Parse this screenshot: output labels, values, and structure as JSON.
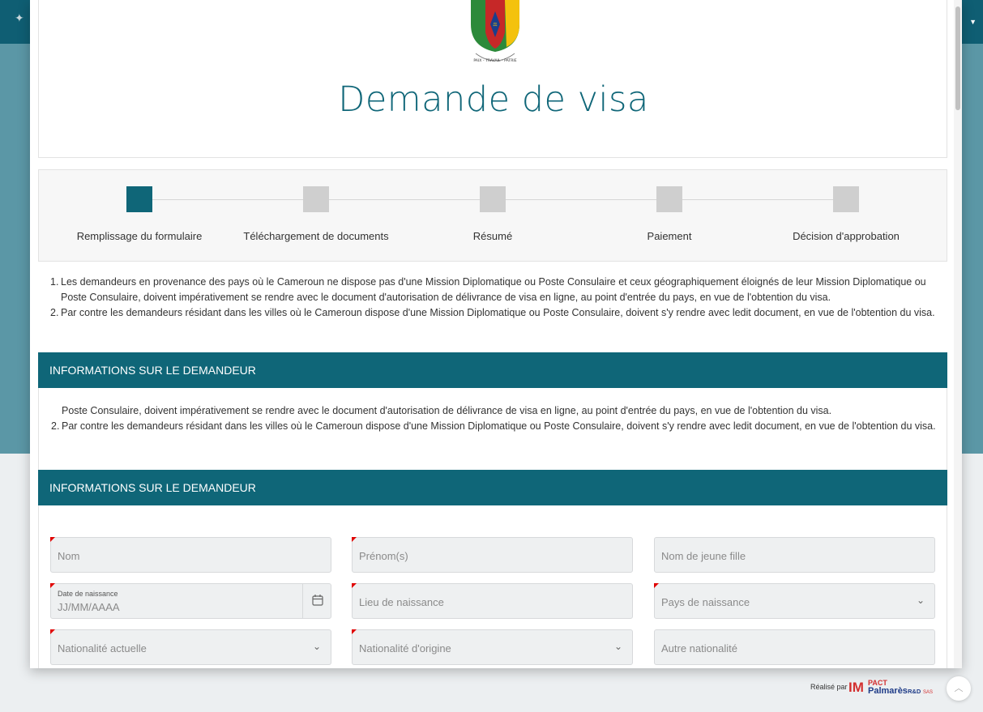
{
  "header": {
    "title": "Demande de visa",
    "emblem_motto": "PAIX - TRAVAIL - PATRIE"
  },
  "steps": [
    {
      "label": "Remplissage du formulaire",
      "active": true
    },
    {
      "label": "Téléchargement de documents",
      "active": false
    },
    {
      "label": "Résumé",
      "active": false
    },
    {
      "label": "Paiement",
      "active": false
    },
    {
      "label": "Décision d'approbation",
      "active": false
    }
  ],
  "notes": {
    "n1": "1.",
    "item1": "Les demandeurs en provenance des pays où le Cameroun ne dispose pas d'une Mission Diplomatique ou Poste Consulaire et ceux géographiquement éloignés de leur Mission Diplomatique ou Poste Consulaire, doivent impérativement se rendre avec le document d'autorisation de délivrance de visa en ligne, au point d'entrée du pays, en vue de l'obtention du visa.",
    "n2": "2.",
    "item2": "Par contre les demandeurs résidant dans les villes où le Cameroun dispose d'une Mission Diplomatique ou Poste Consulaire, doivent s'y rendre avec ledit document, en vue de l'obtention du visa.",
    "item1_tail": "Poste Consulaire, doivent impérativement se rendre avec le document d'autorisation de délivrance de visa en ligne, au point d'entrée du pays, en vue de l'obtention du visa."
  },
  "section": {
    "title": "INFORMATIONS SUR LE DEMANDEUR"
  },
  "form": {
    "nom": "Nom",
    "prenom": "Prénom(s)",
    "nom_jeune_fille": "Nom de jeune fille",
    "date_label": "Date de naissance",
    "date_placeholder": "JJ/MM/AAAA",
    "lieu_naissance": "Lieu de naissance",
    "pays_naissance": "Pays de naissance",
    "nationalite_actuelle": "Nationalité actuelle",
    "nationalite_origine": "Nationalité d'origine",
    "autre_nationalite": "Autre nationalité"
  },
  "footer": {
    "credit": "Réalisé par",
    "logo_text": "IMPACT Palmares R&D SAS"
  },
  "colors": {
    "primary": "#0f6678",
    "inactive_step": "#cfcfcf",
    "required_marker": "#e00000"
  },
  "icons": [
    "calendar-icon",
    "chevron-down-icon",
    "chevron-up-icon",
    "coat-of-arms-emblem"
  ]
}
